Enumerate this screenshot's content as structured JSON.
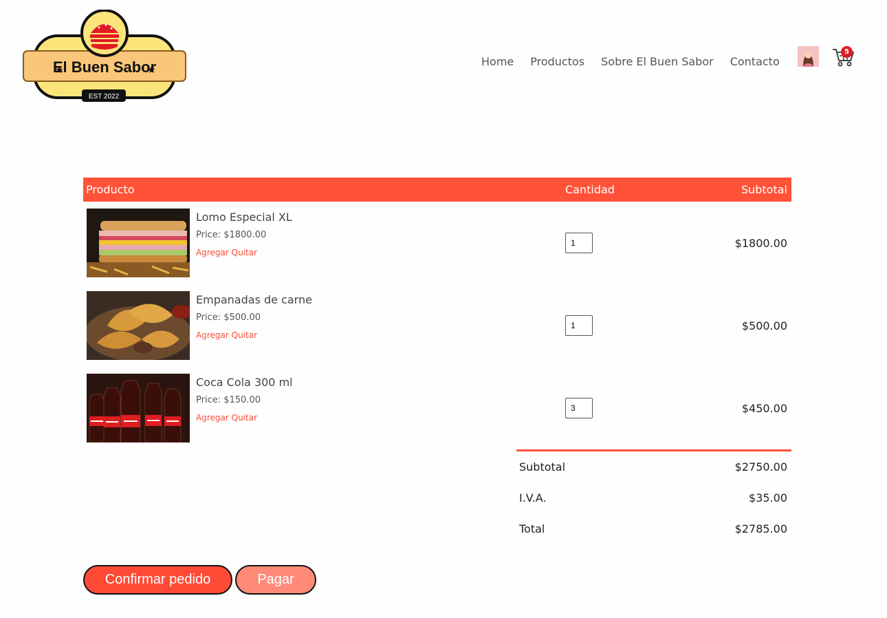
{
  "brand": {
    "name": "El Buen Sabor",
    "est": "EST 2022"
  },
  "nav": {
    "home": "Home",
    "products": "Productos",
    "about": "Sobre El Buen Sabor",
    "contact": "Contacto"
  },
  "cart": {
    "count": "5"
  },
  "table": {
    "headers": {
      "product": "Producto",
      "quantity": "Cantidad",
      "subtotal": "Subtotal"
    },
    "items": [
      {
        "name": "Lomo Especial XL",
        "price": "Price: $1800.00",
        "add": "Agregar",
        "remove": "Quitar",
        "qty": "1",
        "subtotal": "$1800.00",
        "image": "sandwich"
      },
      {
        "name": "Empanadas de carne",
        "price": "Price: $500.00",
        "add": "Agregar",
        "remove": "Quitar",
        "qty": "1",
        "subtotal": "$500.00",
        "image": "empanadas"
      },
      {
        "name": "Coca Cola 300 ml",
        "price": "Price: $150.00",
        "add": "Agregar",
        "remove": "Quitar",
        "qty": "3",
        "subtotal": "$450.00",
        "image": "coca-cola-bottles"
      }
    ]
  },
  "totals": {
    "subtotal_label": "Subtotal",
    "subtotal_value": "$2750.00",
    "iva_label": "I.V.A.",
    "iva_value": "$35.00",
    "total_label": "Total",
    "total_value": "$2785.00"
  },
  "buttons": {
    "confirm": "Confirmar pedido",
    "pay": "Pagar"
  },
  "colors": {
    "accent": "#ff5238",
    "link": "#ff4a36",
    "pay": "#ff8a78"
  }
}
